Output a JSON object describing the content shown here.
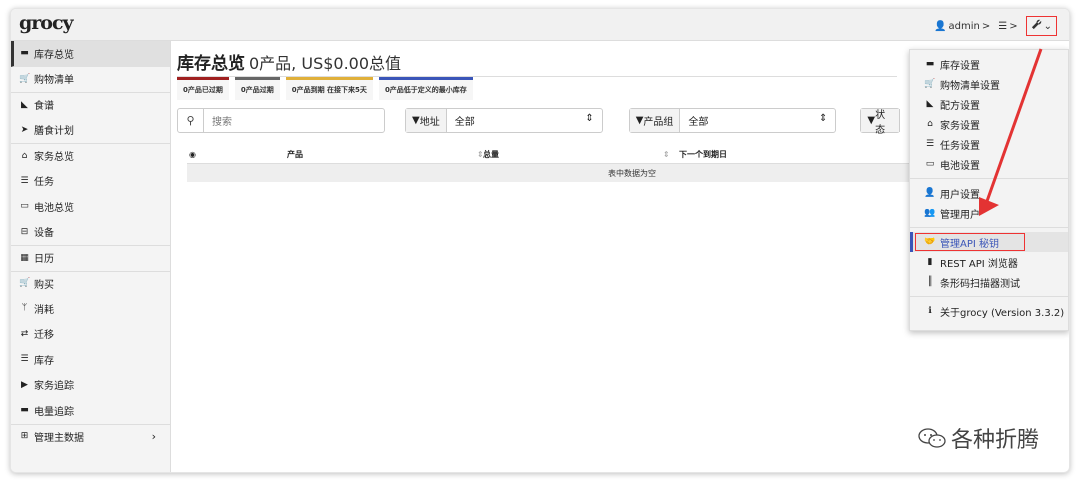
{
  "app": {
    "logo": "grocy"
  },
  "topbar": {
    "user": "admin",
    "user_chevron": ">",
    "settings_chevron": ">"
  },
  "sidebar": {
    "items": [
      {
        "label": "库存总览",
        "icon": "box-icon"
      },
      {
        "label": "购物清单",
        "icon": "cart-icon"
      },
      {
        "label": "食谱",
        "icon": "pizza-icon"
      },
      {
        "label": "膳食计划",
        "icon": "paper-plane-icon"
      },
      {
        "label": "家务总览",
        "icon": "home-icon"
      },
      {
        "label": "任务",
        "icon": "list-icon"
      },
      {
        "label": "电池总览",
        "icon": "battery-icon"
      },
      {
        "label": "设备",
        "icon": "toolbox-icon"
      },
      {
        "label": "日历",
        "icon": "calendar-icon"
      },
      {
        "label": "购买",
        "icon": "cart-plus-icon"
      },
      {
        "label": "消耗",
        "icon": "utensils-icon"
      },
      {
        "label": "迁移",
        "icon": "exchange-icon"
      },
      {
        "label": "库存",
        "icon": "list-icon"
      },
      {
        "label": "家务追踪",
        "icon": "play-icon"
      },
      {
        "label": "电量追踪",
        "icon": "car-battery-icon"
      },
      {
        "label": "管理主数据",
        "icon": "table-icon"
      }
    ]
  },
  "main": {
    "title": "库存总览",
    "subtitle": "0产品, US$0.00总值",
    "badges": [
      "0产品已过期",
      "0产品过期",
      "0产品到期 在接下来5天",
      "0产品低于定义的最小库存"
    ],
    "search_placeholder": "搜索",
    "filter_location_label": "地址",
    "filter_location_value": "全部",
    "filter_group_label": "产品组",
    "filter_group_value": "全部",
    "filter_status_label": "状态",
    "table_headers": {
      "product": "产品",
      "amount": "总量",
      "next_due": "下一个到期日"
    },
    "empty_text": "表中数据为空"
  },
  "dropdown": {
    "items": [
      {
        "label": "库存设置",
        "icon": "box-icon"
      },
      {
        "label": "购物清单设置",
        "icon": "cart-icon"
      },
      {
        "label": "配方设置",
        "icon": "pizza-icon"
      },
      {
        "label": "家务设置",
        "icon": "home-icon"
      },
      {
        "label": "任务设置",
        "icon": "list-icon"
      },
      {
        "label": "电池设置",
        "icon": "battery-icon"
      },
      {
        "label": "用户设置",
        "icon": "user-cog-icon"
      },
      {
        "label": "管理用户",
        "icon": "users-icon"
      },
      {
        "label": "管理API 秘钥",
        "icon": "handshake-icon"
      },
      {
        "label": "REST API 浏览器",
        "icon": "book-icon"
      },
      {
        "label": "条形码扫描器测试",
        "icon": "barcode-icon"
      },
      {
        "label": "关于grocy (Version 3.3.2)",
        "icon": "info-icon"
      }
    ]
  },
  "watermark": {
    "text": "各种折腾"
  },
  "colors": {
    "highlight_red": "#e33333",
    "accent_blue": "#3a55b8"
  }
}
